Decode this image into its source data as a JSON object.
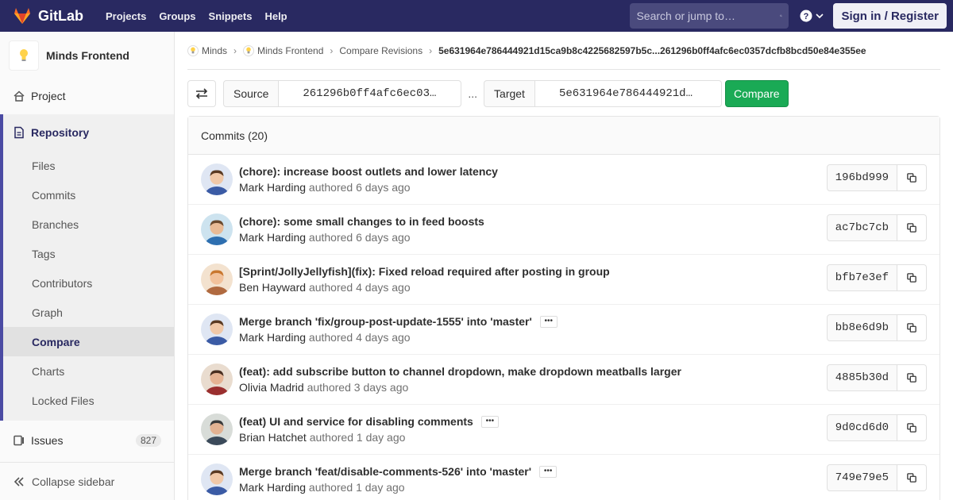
{
  "navbar": {
    "brand": "GitLab",
    "links": [
      "Projects",
      "Groups",
      "Snippets",
      "Help"
    ],
    "search_placeholder": "Search or jump to…",
    "signin_label": "Sign in / Register",
    "brand_color": "#292961"
  },
  "sidebar": {
    "project_name": "Minds Frontend",
    "project_label": "Project",
    "repository_label": "Repository",
    "repo_items": [
      "Files",
      "Commits",
      "Branches",
      "Tags",
      "Contributors",
      "Graph",
      "Compare",
      "Charts",
      "Locked Files"
    ],
    "active_item": "Compare",
    "issues_label": "Issues",
    "issues_count": "827",
    "collapse_label": "Collapse sidebar"
  },
  "breadcrumbs": {
    "items": [
      "Minds",
      "Minds Frontend",
      "Compare Revisions"
    ],
    "current": "5e631964e786444921d15ca9b8c4225682597b5c...261296b0ff4afc6ec0357dcfb8bcd50e84e355ee"
  },
  "compare": {
    "source_label": "Source",
    "source_value": "261296b0ff4afc6ec03…",
    "separator": "...",
    "target_label": "Target",
    "target_value": "5e631964e786444921d…",
    "button_label": "Compare",
    "button_color": "#1aaa55"
  },
  "commits": {
    "header": "Commits (20)",
    "authored_word": "authored",
    "items": [
      {
        "title": "(chore): increase boost outlets and lower latency",
        "author": "Mark Harding",
        "time": "6 days ago",
        "sha": "196bd999",
        "has_ellipsis": false
      },
      {
        "title": "(chore): some small changes to in feed boosts",
        "author": "Mark Harding",
        "time": "6 days ago",
        "sha": "ac7bc7cb",
        "has_ellipsis": false
      },
      {
        "title": "[Sprint/JollyJellyfish](fix): Fixed reload required after posting in group",
        "author": "Ben Hayward",
        "time": "4 days ago",
        "sha": "bfb7e3ef",
        "has_ellipsis": false
      },
      {
        "title": "Merge branch 'fix/group-post-update-1555' into 'master'",
        "author": "Mark Harding",
        "time": "4 days ago",
        "sha": "bb8e6d9b",
        "has_ellipsis": true
      },
      {
        "title": "(feat): add subscribe button to channel dropdown, make dropdown meatballs larger",
        "author": "Olivia Madrid",
        "time": "3 days ago",
        "sha": "4885b30d",
        "has_ellipsis": false
      },
      {
        "title": "(feat) UI and service for disabling comments",
        "author": "Brian Hatchet",
        "time": "1 day ago",
        "sha": "9d0cd6d0",
        "has_ellipsis": true
      },
      {
        "title": "Merge branch 'feat/disable-comments-526' into 'master'",
        "author": "Mark Harding",
        "time": "1 day ago",
        "sha": "749e79e5",
        "has_ellipsis": true
      }
    ]
  }
}
